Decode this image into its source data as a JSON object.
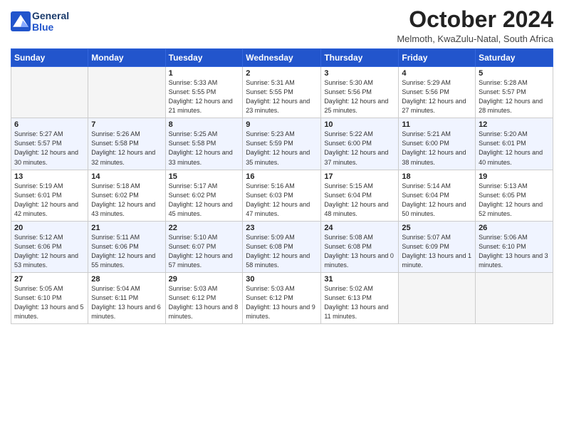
{
  "logo": {
    "line1": "General",
    "line2": "Blue"
  },
  "header": {
    "month": "October 2024",
    "location": "Melmoth, KwaZulu-Natal, South Africa"
  },
  "weekdays": [
    "Sunday",
    "Monday",
    "Tuesday",
    "Wednesday",
    "Thursday",
    "Friday",
    "Saturday"
  ],
  "weeks": [
    [
      {
        "day": "",
        "info": ""
      },
      {
        "day": "",
        "info": ""
      },
      {
        "day": "1",
        "info": "Sunrise: 5:33 AM\nSunset: 5:55 PM\nDaylight: 12 hours and 21 minutes."
      },
      {
        "day": "2",
        "info": "Sunrise: 5:31 AM\nSunset: 5:55 PM\nDaylight: 12 hours and 23 minutes."
      },
      {
        "day": "3",
        "info": "Sunrise: 5:30 AM\nSunset: 5:56 PM\nDaylight: 12 hours and 25 minutes."
      },
      {
        "day": "4",
        "info": "Sunrise: 5:29 AM\nSunset: 5:56 PM\nDaylight: 12 hours and 27 minutes."
      },
      {
        "day": "5",
        "info": "Sunrise: 5:28 AM\nSunset: 5:57 PM\nDaylight: 12 hours and 28 minutes."
      }
    ],
    [
      {
        "day": "6",
        "info": "Sunrise: 5:27 AM\nSunset: 5:57 PM\nDaylight: 12 hours and 30 minutes."
      },
      {
        "day": "7",
        "info": "Sunrise: 5:26 AM\nSunset: 5:58 PM\nDaylight: 12 hours and 32 minutes."
      },
      {
        "day": "8",
        "info": "Sunrise: 5:25 AM\nSunset: 5:58 PM\nDaylight: 12 hours and 33 minutes."
      },
      {
        "day": "9",
        "info": "Sunrise: 5:23 AM\nSunset: 5:59 PM\nDaylight: 12 hours and 35 minutes."
      },
      {
        "day": "10",
        "info": "Sunrise: 5:22 AM\nSunset: 6:00 PM\nDaylight: 12 hours and 37 minutes."
      },
      {
        "day": "11",
        "info": "Sunrise: 5:21 AM\nSunset: 6:00 PM\nDaylight: 12 hours and 38 minutes."
      },
      {
        "day": "12",
        "info": "Sunrise: 5:20 AM\nSunset: 6:01 PM\nDaylight: 12 hours and 40 minutes."
      }
    ],
    [
      {
        "day": "13",
        "info": "Sunrise: 5:19 AM\nSunset: 6:01 PM\nDaylight: 12 hours and 42 minutes."
      },
      {
        "day": "14",
        "info": "Sunrise: 5:18 AM\nSunset: 6:02 PM\nDaylight: 12 hours and 43 minutes."
      },
      {
        "day": "15",
        "info": "Sunrise: 5:17 AM\nSunset: 6:02 PM\nDaylight: 12 hours and 45 minutes."
      },
      {
        "day": "16",
        "info": "Sunrise: 5:16 AM\nSunset: 6:03 PM\nDaylight: 12 hours and 47 minutes."
      },
      {
        "day": "17",
        "info": "Sunrise: 5:15 AM\nSunset: 6:04 PM\nDaylight: 12 hours and 48 minutes."
      },
      {
        "day": "18",
        "info": "Sunrise: 5:14 AM\nSunset: 6:04 PM\nDaylight: 12 hours and 50 minutes."
      },
      {
        "day": "19",
        "info": "Sunrise: 5:13 AM\nSunset: 6:05 PM\nDaylight: 12 hours and 52 minutes."
      }
    ],
    [
      {
        "day": "20",
        "info": "Sunrise: 5:12 AM\nSunset: 6:06 PM\nDaylight: 12 hours and 53 minutes."
      },
      {
        "day": "21",
        "info": "Sunrise: 5:11 AM\nSunset: 6:06 PM\nDaylight: 12 hours and 55 minutes."
      },
      {
        "day": "22",
        "info": "Sunrise: 5:10 AM\nSunset: 6:07 PM\nDaylight: 12 hours and 57 minutes."
      },
      {
        "day": "23",
        "info": "Sunrise: 5:09 AM\nSunset: 6:08 PM\nDaylight: 12 hours and 58 minutes."
      },
      {
        "day": "24",
        "info": "Sunrise: 5:08 AM\nSunset: 6:08 PM\nDaylight: 13 hours and 0 minutes."
      },
      {
        "day": "25",
        "info": "Sunrise: 5:07 AM\nSunset: 6:09 PM\nDaylight: 13 hours and 1 minute."
      },
      {
        "day": "26",
        "info": "Sunrise: 5:06 AM\nSunset: 6:10 PM\nDaylight: 13 hours and 3 minutes."
      }
    ],
    [
      {
        "day": "27",
        "info": "Sunrise: 5:05 AM\nSunset: 6:10 PM\nDaylight: 13 hours and 5 minutes."
      },
      {
        "day": "28",
        "info": "Sunrise: 5:04 AM\nSunset: 6:11 PM\nDaylight: 13 hours and 6 minutes."
      },
      {
        "day": "29",
        "info": "Sunrise: 5:03 AM\nSunset: 6:12 PM\nDaylight: 13 hours and 8 minutes."
      },
      {
        "day": "30",
        "info": "Sunrise: 5:03 AM\nSunset: 6:12 PM\nDaylight: 13 hours and 9 minutes."
      },
      {
        "day": "31",
        "info": "Sunrise: 5:02 AM\nSunset: 6:13 PM\nDaylight: 13 hours and 11 minutes."
      },
      {
        "day": "",
        "info": ""
      },
      {
        "day": "",
        "info": ""
      }
    ]
  ]
}
